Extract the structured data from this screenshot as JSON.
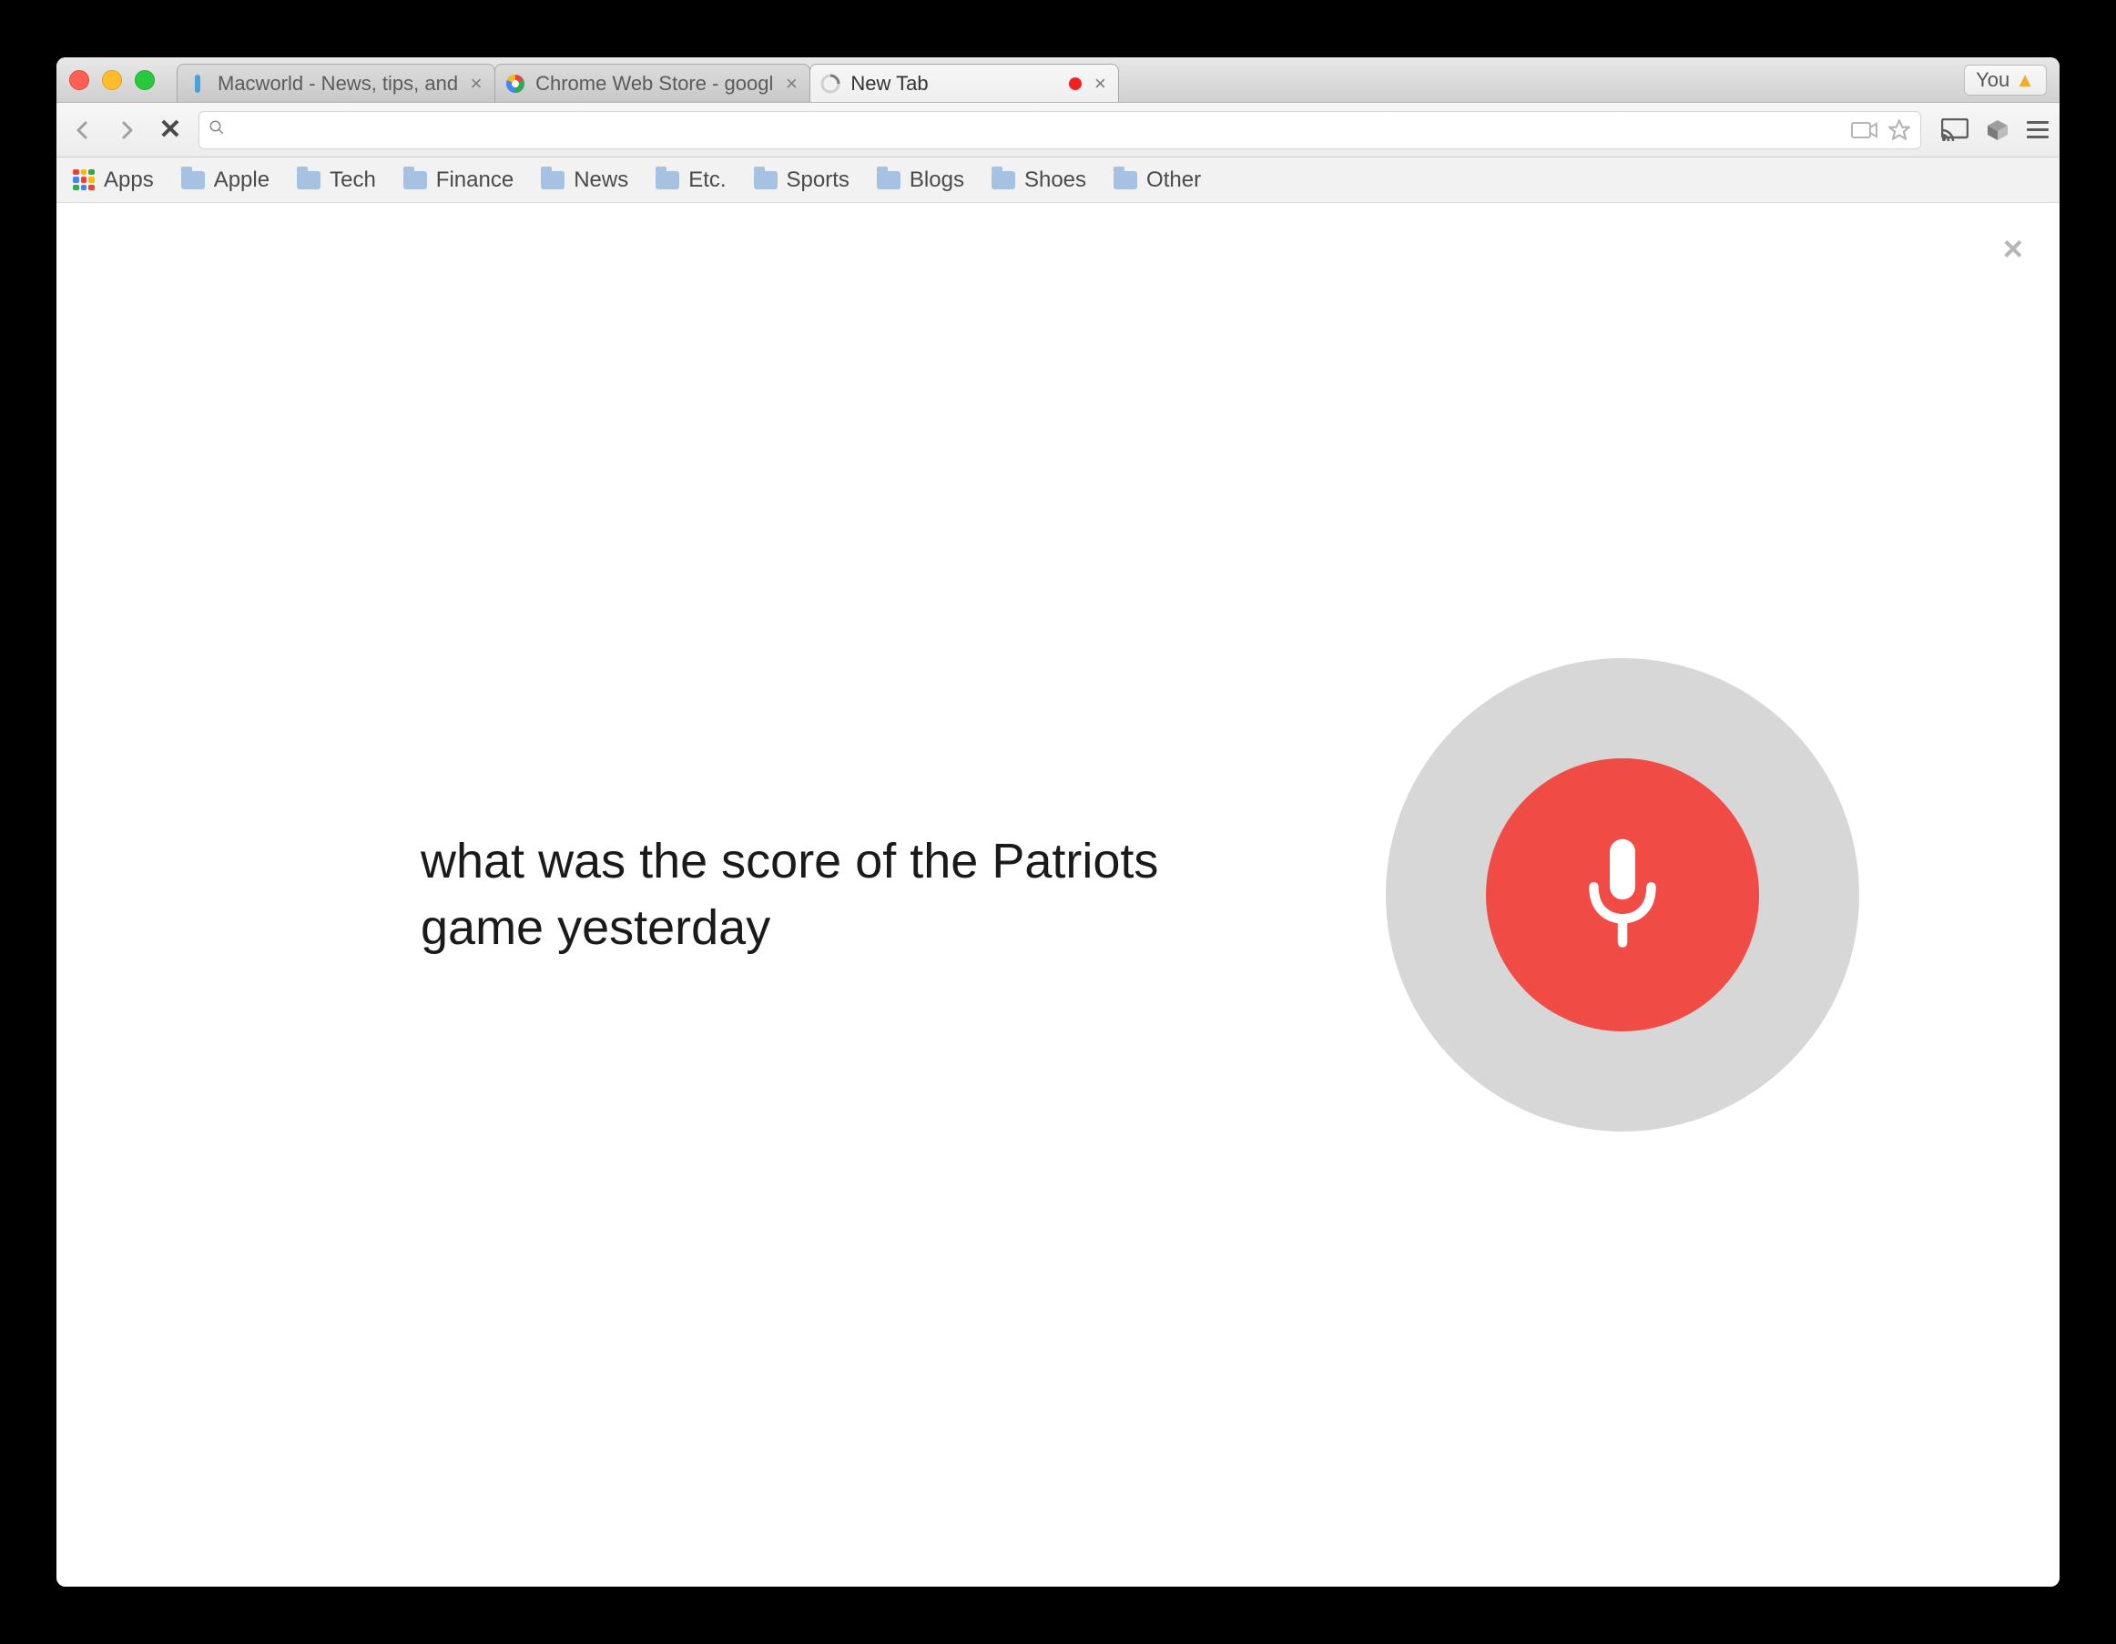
{
  "tabs": [
    {
      "title": "Macworld - News, tips, and"
    },
    {
      "title": "Chrome Web Store - googl"
    },
    {
      "title": "New Tab"
    }
  ],
  "active_tab_index": 2,
  "user_button": "You",
  "omnibox": {
    "value": "",
    "placeholder": ""
  },
  "bookmarks": {
    "apps_label": "Apps",
    "folders": [
      "Apple",
      "Tech",
      "Finance",
      "News",
      "Etc.",
      "Sports",
      "Blogs",
      "Shoes",
      "Other"
    ]
  },
  "voice": {
    "transcript": "what was the score of the Patriots game yesterday"
  }
}
